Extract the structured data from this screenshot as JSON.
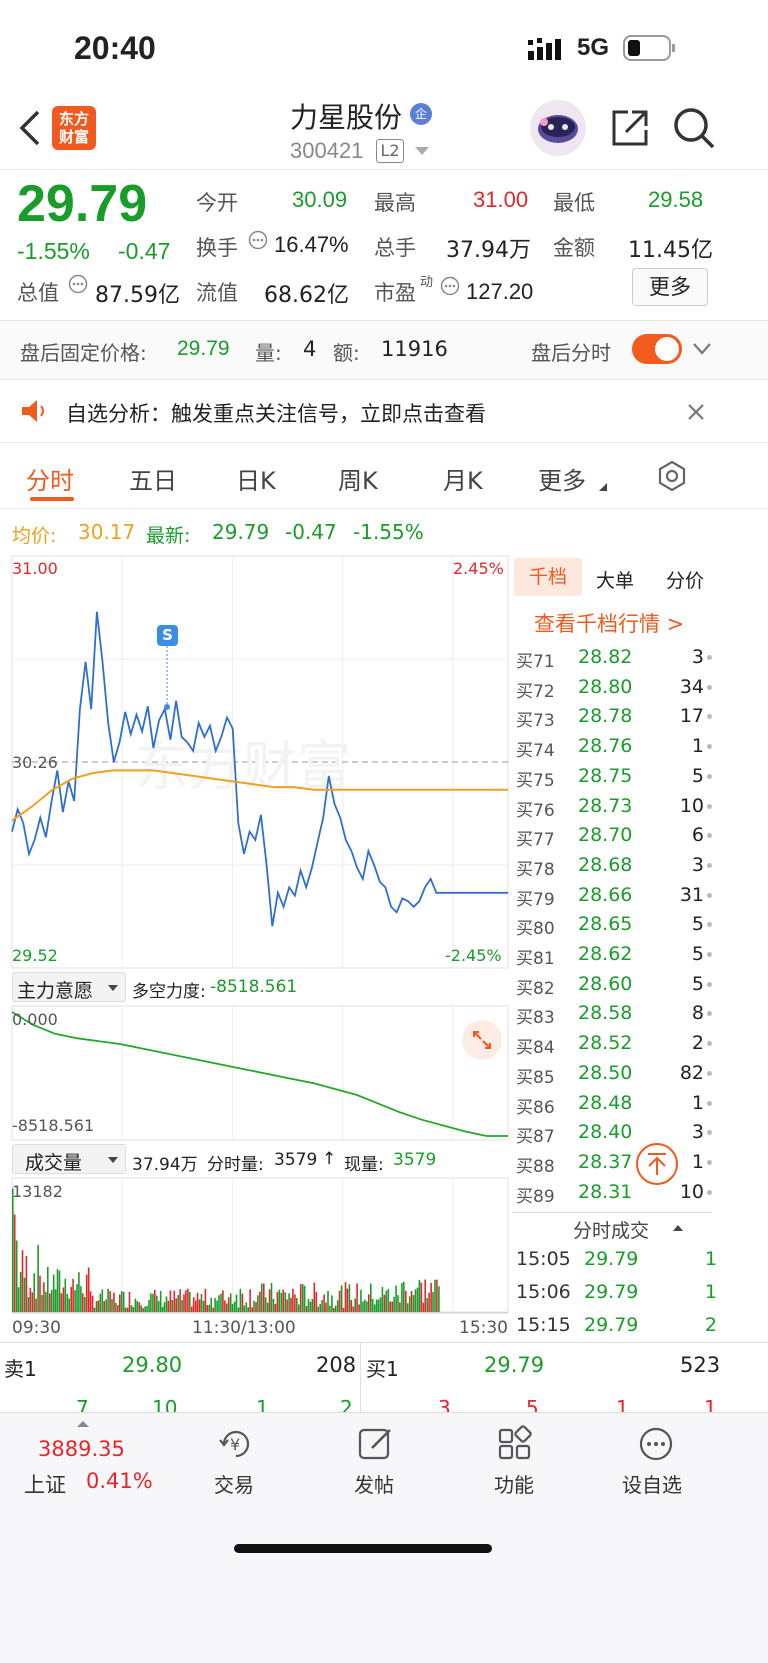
{
  "status_bar": {
    "time": "20:40",
    "network": "5G"
  },
  "header": {
    "logo_line1": "东方",
    "logo_line2": "财富",
    "stock_name": "力星股份",
    "badge": "企",
    "stock_code": "300421",
    "level": "L2"
  },
  "quote": {
    "price": "29.79",
    "pct": "-1.55%",
    "chg": "-0.47",
    "open_label": "今开",
    "open": "30.09",
    "high_label": "最高",
    "high": "31.00",
    "low_label": "最低",
    "low": "29.58",
    "turnover_label": "换手",
    "turnover": "16.47%",
    "vol_label": "总手",
    "vol": "37.94万",
    "amt_label": "金额",
    "amt": "11.45亿",
    "mktcap_label": "总值",
    "mktcap": "87.59亿",
    "float_label": "流值",
    "float": "68.62亿",
    "pe_label": "市盈",
    "pe_sup": "动",
    "pe": "127.20",
    "more": "更多"
  },
  "after_hours": {
    "label": "盘后固定价格:",
    "price": "29.79",
    "vol_label": "量:",
    "vol": "4",
    "amt_label": "额:",
    "amt": "11916",
    "toggle_label": "盘后分时",
    "toggle_on": true
  },
  "notice": {
    "text": "自选分析：触发重点关注信号，立即点击查看"
  },
  "tabs": [
    "分时",
    "五日",
    "日K",
    "周K",
    "月K",
    "更多"
  ],
  "summary": {
    "avg_label": "均价:",
    "avg": "30.17",
    "latest_label": "最新:",
    "latest": "29.79",
    "chg": "-0.47",
    "pct": "-1.55%"
  },
  "chart_data": [
    {
      "type": "line",
      "title": "分时",
      "y_labels": {
        "top": "31.00",
        "bottom": "29.52",
        "ref": "30.26",
        "pct_top": "2.45%",
        "pct_bottom": "-2.45%"
      },
      "ylim": [
        29.52,
        31.0
      ],
      "x_labels": [
        "09:30",
        "11:30/13:00",
        "15:30"
      ],
      "series": [
        {
          "name": "最新",
          "color": "#2f6fd0",
          "values": [
            30.01,
            30.09,
            30.04,
            29.93,
            29.98,
            30.06,
            29.99,
            30.12,
            30.23,
            30.08,
            30.19,
            30.12,
            30.45,
            30.62,
            30.45,
            30.8,
            30.62,
            30.4,
            30.26,
            30.33,
            30.44,
            30.36,
            30.43,
            30.37,
            30.46,
            30.31,
            30.41,
            30.45,
            30.34,
            30.48,
            30.35,
            30.33,
            30.3,
            30.4,
            30.35,
            30.39,
            30.3,
            30.35,
            30.42,
            30.38,
            30.04,
            29.93,
            30.01,
            29.98,
            30.07,
            29.89,
            29.67,
            29.79,
            29.74,
            29.81,
            29.78,
            29.87,
            29.81,
            29.88,
            29.97,
            30.06,
            30.21,
            30.11,
            30.06,
            29.98,
            29.94,
            29.88,
            29.84,
            29.94,
            29.89,
            29.83,
            29.81,
            29.74,
            29.72,
            29.77,
            29.76,
            29.74,
            29.76,
            29.81,
            29.84,
            29.79,
            29.79,
            29.79,
            29.79,
            29.79,
            29.79,
            29.79,
            29.79,
            29.79
          ]
        },
        {
          "name": "均价",
          "color": "#f0a020",
          "values": [
            30.05,
            30.1,
            30.16,
            30.2,
            30.22,
            30.23,
            30.23,
            30.23,
            30.22,
            30.21,
            30.2,
            30.19,
            30.18,
            30.17,
            30.17,
            30.16,
            30.16,
            30.16,
            30.16,
            30.16,
            30.16,
            30.16,
            30.16
          ]
        }
      ],
      "buy_point_label": "S"
    },
    {
      "type": "line",
      "title": "主力意愿",
      "indicator_label": "多空力度:",
      "indicator_value": "-8518.561",
      "y_labels": {
        "top": "0.000",
        "bottom": "-8518.561"
      },
      "ylim": [
        -8518.561,
        0
      ],
      "series": [
        {
          "name": "多空力度",
          "color": "#22a82a",
          "values": [
            0,
            -900,
            -1500,
            -1800,
            -2000,
            -2200,
            -2500,
            -2800,
            -3100,
            -3400,
            -3700,
            -4000,
            -4300,
            -4600,
            -4900,
            -5300,
            -5700,
            -6300,
            -6900,
            -7400,
            -7800,
            -8200,
            -8518.561,
            -8518.561
          ]
        }
      ]
    },
    {
      "type": "bar",
      "title": "成交量",
      "vol_total": "37.94万",
      "minute_vol_label": "分时量:",
      "minute_vol": "3579",
      "now_vol_label": "现量:",
      "now_vol": "3579",
      "y_max_label": "13182",
      "ylim": [
        0,
        13182
      ],
      "note": "volume bars alternate red/green following price moves"
    }
  ],
  "order_book": {
    "tabs": [
      "千档",
      "大单",
      "分价"
    ],
    "link": "查看千档行情 >",
    "rows": [
      {
        "label": "买71",
        "price": "28.82",
        "vol": "3"
      },
      {
        "label": "买72",
        "price": "28.80",
        "vol": "34"
      },
      {
        "label": "买73",
        "price": "28.78",
        "vol": "17"
      },
      {
        "label": "买74",
        "price": "28.76",
        "vol": "1"
      },
      {
        "label": "买75",
        "price": "28.75",
        "vol": "5"
      },
      {
        "label": "买76",
        "price": "28.73",
        "vol": "10"
      },
      {
        "label": "买77",
        "price": "28.70",
        "vol": "6"
      },
      {
        "label": "买78",
        "price": "28.68",
        "vol": "3"
      },
      {
        "label": "买79",
        "price": "28.66",
        "vol": "31"
      },
      {
        "label": "买80",
        "price": "28.65",
        "vol": "5"
      },
      {
        "label": "买81",
        "price": "28.62",
        "vol": "5"
      },
      {
        "label": "买82",
        "price": "28.60",
        "vol": "5"
      },
      {
        "label": "买83",
        "price": "28.58",
        "vol": "8"
      },
      {
        "label": "买84",
        "price": "28.52",
        "vol": "2"
      },
      {
        "label": "买85",
        "price": "28.50",
        "vol": "82"
      },
      {
        "label": "买86",
        "price": "28.48",
        "vol": "1"
      },
      {
        "label": "买87",
        "price": "28.40",
        "vol": "3"
      },
      {
        "label": "买88",
        "price": "28.37",
        "vol": "1"
      },
      {
        "label": "买89",
        "price": "28.31",
        "vol": "10"
      }
    ],
    "trades_title": "分时成交",
    "trades": [
      {
        "time": "15:05",
        "price": "29.79",
        "vol": "1"
      },
      {
        "time": "15:06",
        "price": "29.79",
        "vol": "1"
      },
      {
        "time": "15:15",
        "price": "29.79",
        "vol": "2"
      }
    ]
  },
  "level1": {
    "sell_label": "卖1",
    "sell_price": "29.80",
    "sell_vol": "208",
    "buy_label": "买1",
    "buy_price": "29.79",
    "buy_vol": "523",
    "sub_left": [
      "7",
      "10",
      "1",
      "2"
    ],
    "sub_right": [
      "3",
      "5",
      "1",
      "1"
    ]
  },
  "bottom_nav": {
    "index_value": "3889.35",
    "index_name": "上证",
    "index_pct": "0.41%",
    "items": [
      "交易",
      "发帖",
      "功能",
      "设自选"
    ]
  }
}
